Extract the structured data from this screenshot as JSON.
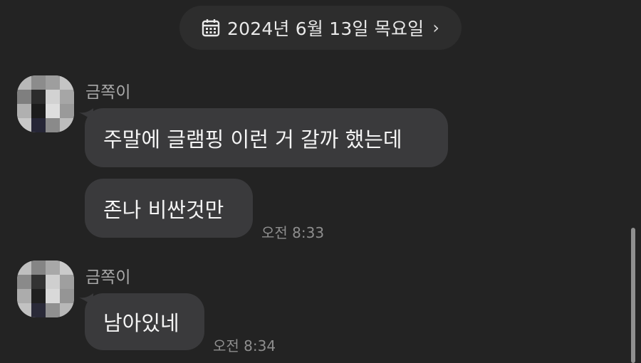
{
  "date_header": {
    "text": "2024년 6월 13일 목요일",
    "chevron": "›",
    "icon": "calendar-icon"
  },
  "messages": [
    {
      "sender": "금쪽이",
      "bubbles": [
        "주말에 글램핑 이런 거 갈까 했는데",
        "존나 비싼것만"
      ],
      "time": "오전 8:33"
    },
    {
      "sender": "금쪽이",
      "bubbles": [
        "남아있네"
      ],
      "time": "오전 8:34"
    }
  ],
  "colors": {
    "background": "#232323",
    "bubble": "#3a3a3c",
    "pill": "#2d2d2d",
    "sender_text": "#a9a9a9",
    "time_text": "#8e8e8e"
  }
}
